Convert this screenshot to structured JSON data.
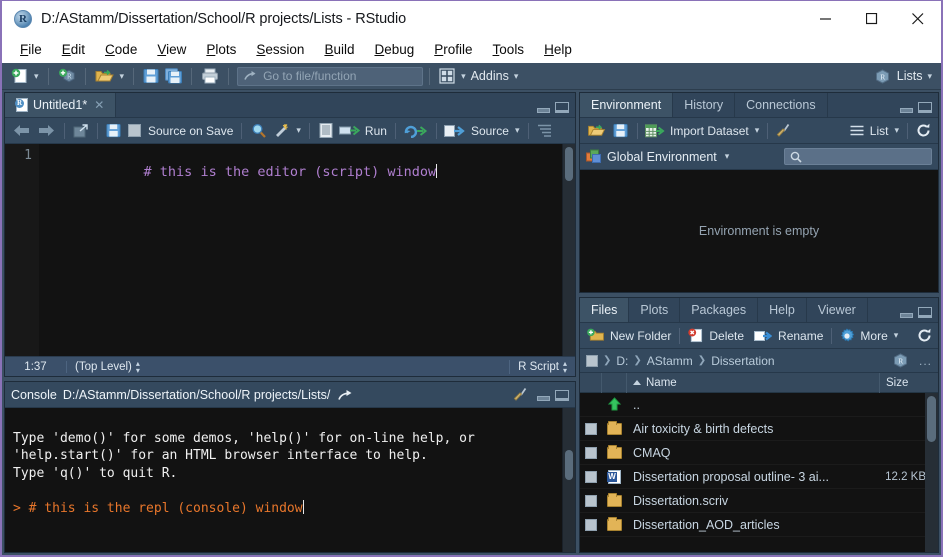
{
  "window": {
    "title": "D:/AStamm/Dissertation/School/R projects/Lists - RStudio",
    "app_icon": "rstudio-icon",
    "minimize": "minimize-icon",
    "maximize": "maximize-icon",
    "close": "close-icon"
  },
  "menubar": {
    "items": [
      {
        "label": "File",
        "accel": "F"
      },
      {
        "label": "Edit",
        "accel": "E"
      },
      {
        "label": "Code",
        "accel": "C"
      },
      {
        "label": "View",
        "accel": "V"
      },
      {
        "label": "Plots",
        "accel": "P"
      },
      {
        "label": "Session",
        "accel": "S"
      },
      {
        "label": "Build",
        "accel": "B"
      },
      {
        "label": "Debug",
        "accel": "D"
      },
      {
        "label": "Profile",
        "accel": "P"
      },
      {
        "label": "Tools",
        "accel": "T"
      },
      {
        "label": "Help",
        "accel": "H"
      }
    ]
  },
  "toolbar": {
    "new_file": "new-file-icon",
    "new_project": "new-project-icon",
    "open_file": "open-folder-icon",
    "save": "save-icon",
    "save_all": "save-all-icon",
    "print": "print-icon",
    "goto_placeholder": "Go to file/function",
    "panes_icon": "panes-icon",
    "addins_label": "Addins",
    "project_label": "Lists",
    "project_icon": "rproject-icon"
  },
  "editor": {
    "tab": {
      "label": "Untitled1*",
      "icon": "r-script-icon",
      "close": "close-tab-icon"
    },
    "toolbar": {
      "back": "back-arrow-icon",
      "forward": "forward-arrow-icon",
      "popout": "show-in-new-window-icon",
      "save": "save-icon",
      "source_on_save_label": "Source on Save",
      "find": "magnifier-icon",
      "magic": "code-tools-icon",
      "compile_report": "compile-report-icon",
      "run_label": "Run",
      "rerun": "rerun-icon",
      "source_label": "Source",
      "outline": "document-outline-icon"
    },
    "lines": [
      {
        "number": "1",
        "text": "# this is the editor (script) window"
      }
    ],
    "status": {
      "position": "1:37",
      "scope": "(Top Level)",
      "filetype": "R Script"
    }
  },
  "console": {
    "title": "Console",
    "path": "D:/AStamm/Dissertation/School/R projects/Lists/",
    "popout_icon": "popout-icon",
    "clear_icon": "broom-icon",
    "output": [
      "Type 'demo()' for some demos, 'help()' for on-line help, or",
      "'help.start()' for an HTML browser interface to help.",
      "Type 'q()' to quit R.",
      ""
    ],
    "prompt_line": "> # this is the repl (console) window"
  },
  "environment": {
    "tabs": [
      {
        "label": "Environment",
        "active": true
      },
      {
        "label": "History",
        "active": false
      },
      {
        "label": "Connections",
        "active": false
      }
    ],
    "toolbar": {
      "load": "open-folder-icon",
      "save": "save-icon",
      "import_label": "Import Dataset",
      "clear": "broom-icon",
      "list_label": "List",
      "list_icon": "list-view-icon",
      "refresh": "refresh-icon"
    },
    "scope_label": "Global Environment",
    "scope_icon": "cube-icon",
    "search_icon": "search-icon",
    "search_value": "",
    "empty_message": "Environment is empty"
  },
  "files": {
    "tabs": [
      {
        "label": "Files",
        "active": true
      },
      {
        "label": "Plots",
        "active": false
      },
      {
        "label": "Packages",
        "active": false
      },
      {
        "label": "Help",
        "active": false
      },
      {
        "label": "Viewer",
        "active": false
      }
    ],
    "toolbar": {
      "new_folder_label": "New Folder",
      "new_folder_icon": "new-folder-icon",
      "delete_label": "Delete",
      "delete_icon": "delete-icon",
      "rename_label": "Rename",
      "rename_icon": "rename-icon",
      "more_label": "More",
      "more_icon": "gear-icon",
      "refresh_icon": "refresh-icon"
    },
    "breadcrumb": [
      "D:",
      "AStamm",
      "Dissertation"
    ],
    "breadcrumb_home_icon": "rproject-icon",
    "breadcrumb_more": "...",
    "columns": {
      "name": "Name",
      "size": "Size"
    },
    "rows": [
      {
        "name": "..",
        "size": "",
        "icon": "up-arrow-icon",
        "checkbox": false
      },
      {
        "name": "Air toxicity & birth defects",
        "size": "",
        "icon": "folder-icon",
        "checkbox": true
      },
      {
        "name": "CMAQ",
        "size": "",
        "icon": "folder-icon",
        "checkbox": true
      },
      {
        "name": "Dissertation proposal outline- 3 ai...",
        "size": "12.2 KB",
        "icon": "word-doc-icon",
        "checkbox": true
      },
      {
        "name": "Dissertation.scriv",
        "size": "",
        "icon": "folder-icon",
        "checkbox": true
      },
      {
        "name": "Dissertation_AOD_articles",
        "size": "",
        "icon": "folder-icon",
        "checkbox": true
      }
    ]
  },
  "colors": {
    "window_border": "#8a72b8",
    "chrome": "#3c5064",
    "pane_bg": "#2c3e50",
    "code_bg": "#121212",
    "comment": "#b07fd0",
    "prompt": "#e8762b",
    "accent_green": "#42c463"
  }
}
